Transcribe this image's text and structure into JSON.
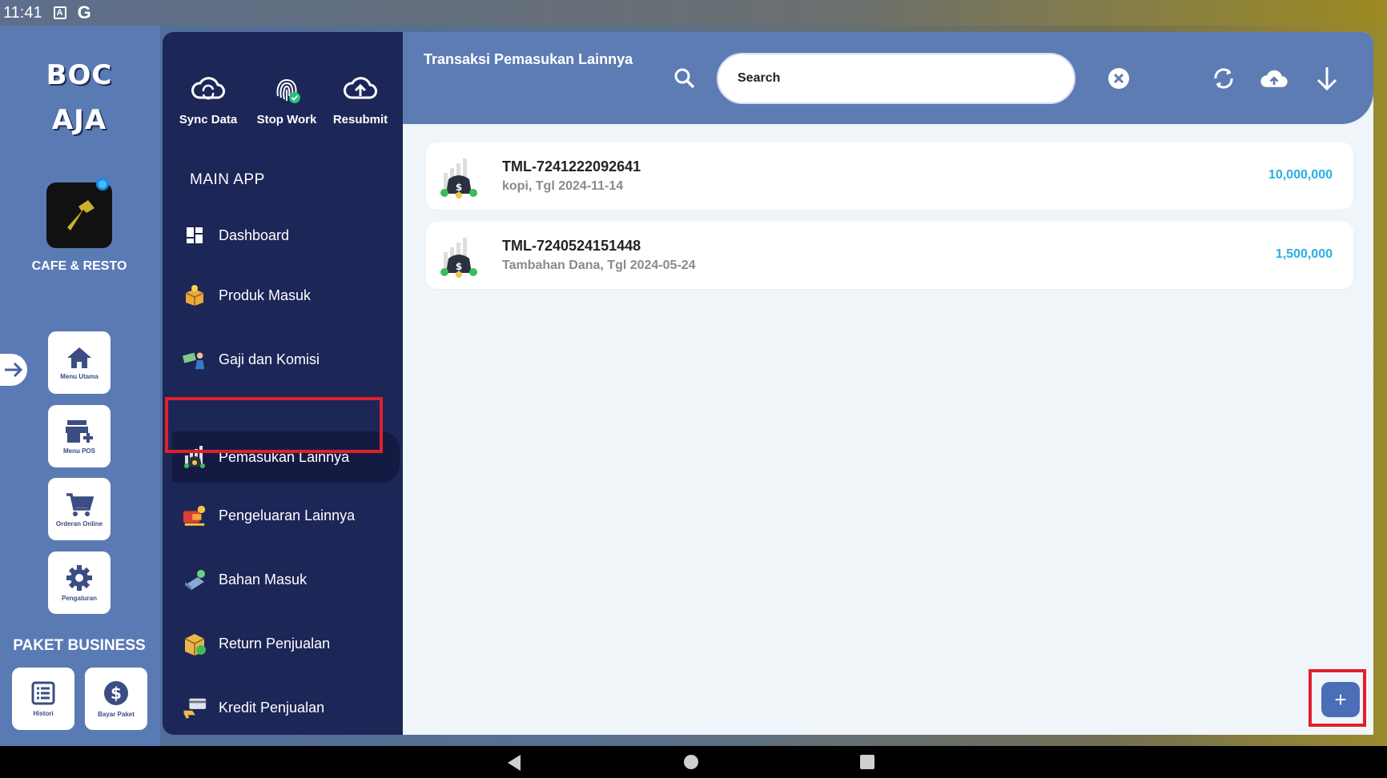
{
  "status_bar": {
    "time": "11:41",
    "icons": [
      "a-icon",
      "google-icon"
    ]
  },
  "rail": {
    "logo_text": "BOC AJA",
    "app_name": "CAFE & RESTO",
    "buttons": [
      {
        "label": "Menu Utama",
        "icon": "home-icon"
      },
      {
        "label": "Menu POS",
        "icon": "store-add-icon"
      },
      {
        "label": "Orderan Online",
        "icon": "cart-icon"
      },
      {
        "label": "Pengaturan",
        "icon": "gear-icon"
      }
    ],
    "paket_title": "PAKET BUSINESS",
    "paket_buttons": [
      {
        "label": "Histori",
        "icon": "list-icon"
      },
      {
        "label": "Bayar Paket",
        "icon": "dollar-icon"
      }
    ]
  },
  "drawer": {
    "top_actions": [
      {
        "label": "Sync Data",
        "icon": "cloud-sync-icon"
      },
      {
        "label": "Stop Work",
        "icon": "fingerprint-icon"
      },
      {
        "label": "Resubmit",
        "icon": "cloud-upload-icon"
      }
    ],
    "section_title": "MAIN APP",
    "items": [
      {
        "label": "Dashboard",
        "icon": "dashboard-icon"
      },
      {
        "label": "Produk Masuk",
        "icon": "box-icon"
      },
      {
        "label": "Gaji dan Komisi",
        "icon": "salary-icon"
      },
      {
        "label": "Pemasukan Lainnya",
        "icon": "income-icon",
        "active": true
      },
      {
        "label": "Pengeluaran Lainnya",
        "icon": "expense-icon"
      },
      {
        "label": "Bahan Masuk",
        "icon": "ingredient-icon"
      },
      {
        "label": "Return Penjualan",
        "icon": "return-icon"
      },
      {
        "label": "Kredit Penjualan",
        "icon": "credit-icon"
      }
    ]
  },
  "main": {
    "title": "Transaksi Pemasukan Lainnya",
    "search": {
      "placeholder": "Search",
      "value": ""
    },
    "transactions": [
      {
        "id": "TML-7241222092641",
        "subtitle": "kopi, Tgl 2024-11-14",
        "amount": "10,000,000"
      },
      {
        "id": "TML-7240524151448",
        "subtitle": "Tambahan Dana, Tgl 2024-05-24",
        "amount": "1,500,000"
      }
    ],
    "fab_label": "+"
  },
  "colors": {
    "accent": "#5d7cb4",
    "drawer": "#1c2657",
    "amount": "#29aee6",
    "highlight": "#e0202a"
  }
}
